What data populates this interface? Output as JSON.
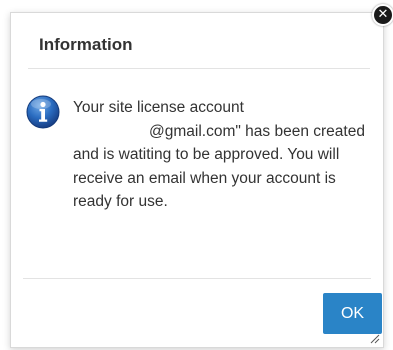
{
  "dialog": {
    "title": "Information",
    "icon": "info-icon",
    "close_icon": "close-icon",
    "message_lines": [
      "Your site license account",
      "@gmail.com\" has been created",
      "and is watiting to be approved. You will",
      "receive an email when your account is",
      "ready for use."
    ],
    "ok_label": "OK",
    "colors": {
      "ok_button": "#2a84c7",
      "info_icon": "#1f5fb0",
      "close_button": "#1a1a1a"
    }
  }
}
